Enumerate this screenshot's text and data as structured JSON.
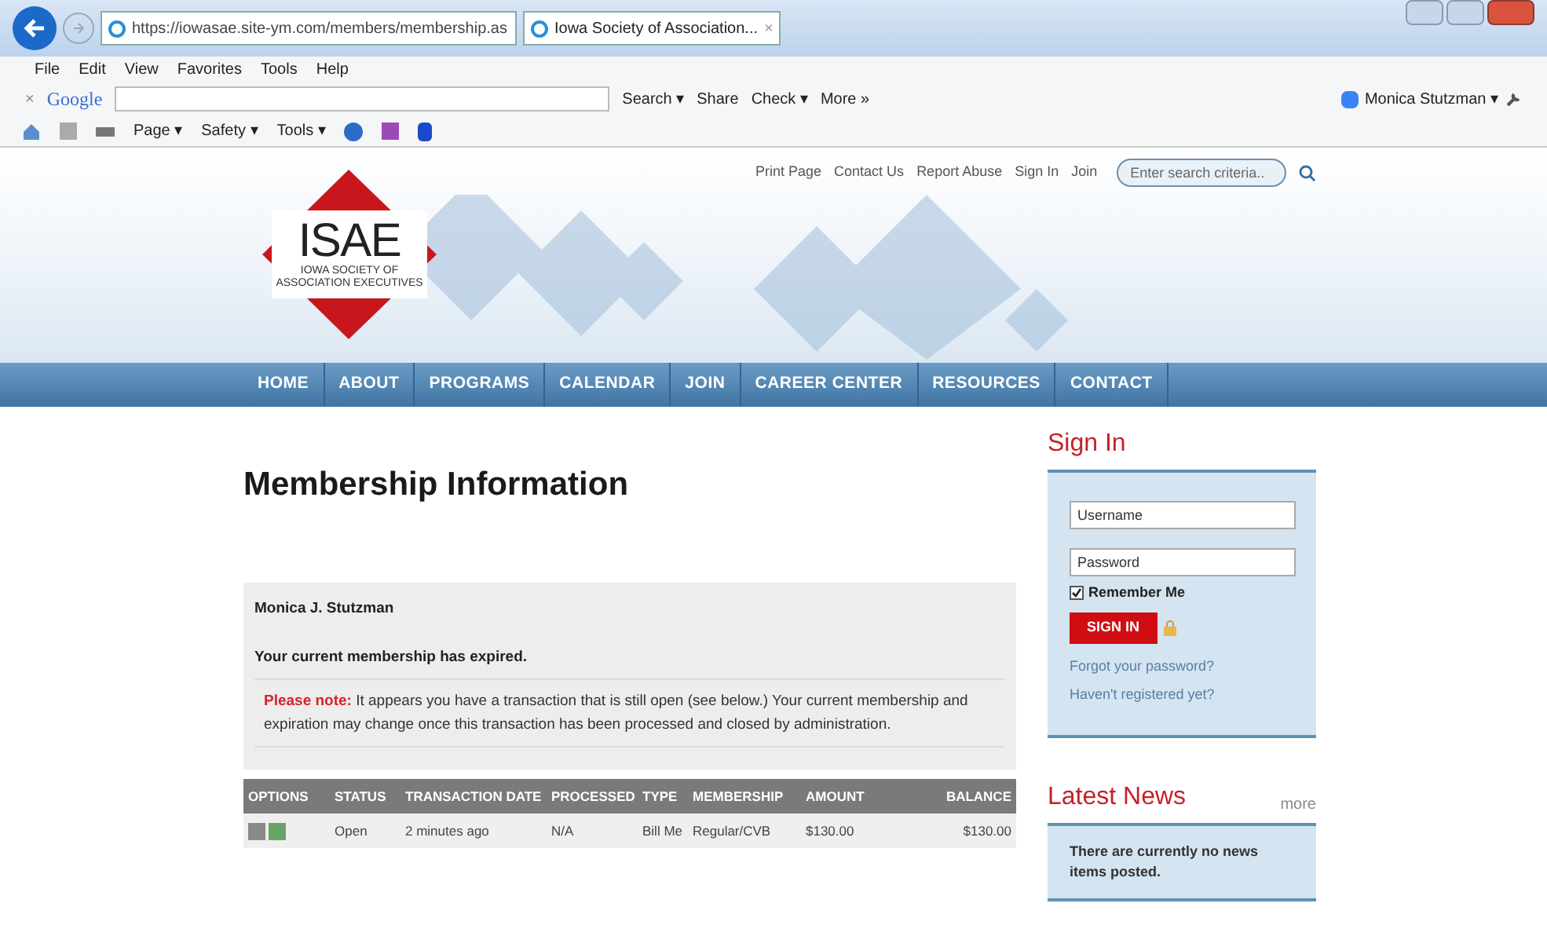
{
  "browser": {
    "address": "https://iowasae.site-ym.com/members/membership.as",
    "tab": {
      "title": "Iowa Society of Association...",
      "close": "×",
      "selected": true
    },
    "menu": [
      "File",
      "Edit",
      "View",
      "Favorites",
      "Tools",
      "Help"
    ],
    "google_toolbar": {
      "close": "×",
      "logo": "Google",
      "buttons": [
        "Search ▾",
        "Share",
        "Check ▾",
        "More »"
      ],
      "user": "Monica Stutzman ▾"
    },
    "command_bar": [
      "Page ▾",
      "Safety ▾",
      "Tools ▾"
    ]
  },
  "page": {
    "top_links": [
      "Print Page",
      "Contact Us",
      "Report Abuse",
      "Sign In",
      "Join"
    ],
    "search": {
      "placeholder": "Enter search criteria.."
    },
    "logo": {
      "mark": "ISAE",
      "lines": [
        "IOWA SOCIETY OF",
        "ASSOCIATION EXECUTIVES"
      ]
    },
    "nav": [
      "HOME",
      "ABOUT",
      "PROGRAMS",
      "CALENDAR",
      "JOIN",
      "CAREER CENTER",
      "RESOURCES",
      "CONTACT"
    ],
    "title": "Membership Information",
    "member_name": "Monica J. Stutzman",
    "status": "Your current membership has expired.",
    "note": {
      "label": "Please note:",
      "text": " It appears you have a transaction that is still open (see below.) Your current membership and expiration may change once this transaction has been processed and closed by administration."
    },
    "table": {
      "columns": [
        "OPTIONS",
        "STATUS",
        "TRANSACTION DATE",
        "PROCESSED",
        "TYPE",
        "MEMBERSHIP",
        "AMOUNT",
        "BALANCE"
      ],
      "rows": [
        {
          "status": "Open",
          "date": "2 minutes ago",
          "processed": "N/A",
          "type": "Bill Me",
          "membership": "Regular/CVB",
          "amount": "$130.00",
          "balance": "$130.00"
        }
      ]
    },
    "sign_in": {
      "heading": "Sign In",
      "username": {
        "placeholder": "Username"
      },
      "password": {
        "placeholder": "Password"
      },
      "remember": {
        "label": "Remember Me",
        "checked": true
      },
      "button": "SIGN IN",
      "links": [
        "Forgot your password?",
        "Haven't registered yet?"
      ]
    },
    "news": {
      "heading": "Latest News",
      "more": "more",
      "message": "There are currently no news items posted."
    }
  }
}
